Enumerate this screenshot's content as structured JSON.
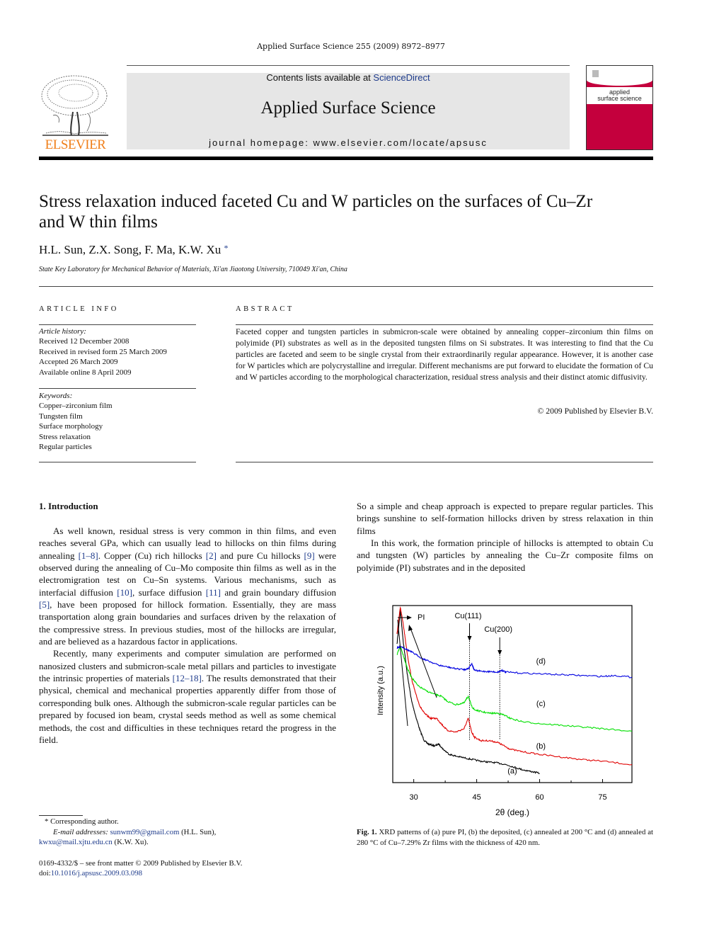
{
  "header": {
    "citation": "Applied Surface Science 255 (2009) 8972–8977",
    "contents_prefix": "Contents lists available at ",
    "contents_link": "ScienceDirect",
    "journal_name": "Applied Surface Science",
    "homepage": "journal homepage: www.elsevier.com/locate/apsusc",
    "publisher_logo_text": "ELSEVIER",
    "cover_line1": "applied",
    "cover_line2": "surface science",
    "colors": {
      "publisher_orange": "#f07f1a",
      "link_blue": "#1f3c8c",
      "cover_red": "#c4003d",
      "banner_gray": "#e6e6e6"
    }
  },
  "article": {
    "title": "Stress relaxation induced faceted Cu and W particles on the surfaces of Cu–Zr and W thin films",
    "authors": "H.L. Sun, Z.X. Song, F. Ma, K.W. Xu",
    "author_mark": "*",
    "affiliation": "State Key Laboratory for Mechanical Behavior of Materials, Xi'an Jiaotong University, 710049 Xi'an, China"
  },
  "article_info": {
    "heading": "ARTICLE INFO",
    "history_label": "Article history:",
    "history": [
      "Received 12 December 2008",
      "Received in revised form 25 March 2009",
      "Accepted 26 March 2009",
      "Available online 8 April 2009"
    ],
    "keywords_label": "Keywords:",
    "keywords": [
      "Copper–zirconium film",
      "Tungsten film",
      "Surface morphology",
      "Stress relaxation",
      "Regular particles"
    ]
  },
  "abstract": {
    "heading": "ABSTRACT",
    "text": "Faceted copper and tungsten particles in submicron-scale were obtained by annealing copper–zirconium thin films on polyimide (PI) substrates as well as in the deposited tungsten films on Si substrates. It was interesting to find that the Cu particles are faceted and seem to be single crystal from their extraordinarily regular appearance. However, it is another case for W particles which are polycrystalline and irregular. Different mechanisms are put forward to elucidate the formation of Cu and W particles according to the morphological characterization, residual stress analysis and their distinct atomic diffusivity.",
    "copyright": "© 2009 Published by Elsevier B.V."
  },
  "introduction": {
    "heading": "1.  Introduction",
    "p1": [
      {
        "t": "As well known, residual stress is very common in thin films, and even reaches several GPa, which can usually lead to hillocks on thin films during annealing "
      },
      {
        "r": "[1–8]"
      },
      {
        "t": ". Copper (Cu) rich hillocks "
      },
      {
        "r": "[2]"
      },
      {
        "t": " and pure Cu hillocks "
      },
      {
        "r": "[9]"
      },
      {
        "t": " were observed during the annealing of Cu–Mo composite thin films as well as in the electromigration test on Cu–Sn systems. Various mechanisms, such as interfacial diffusion "
      },
      {
        "r": "[10]"
      },
      {
        "t": ", surface diffusion "
      },
      {
        "r": "[11]"
      },
      {
        "t": " and grain boundary diffusion "
      },
      {
        "r": "[5]"
      },
      {
        "t": ", have been proposed for hillock formation. Essentially, they are mass transportation along grain boundaries and surfaces driven by the relaxation of the compressive stress. In previous studies, most of the hillocks are irregular, and are believed as a hazardous factor in applications."
      }
    ],
    "p2": [
      {
        "t": "Recently, many experiments and computer simulation are performed on nanosized clusters and submicron-scale metal pillars and particles to investigate the intrinsic properties of materials "
      },
      {
        "r": "[12–18]"
      },
      {
        "t": ". The results demonstrated that their physical, chemical and mechanical properties apparently differ from those of corresponding bulk ones. Although the submicron-scale regular particles can be prepared by focused ion beam, crystal seeds method as well as some chemical methods, the cost and difficulties in these techniques retard the progress in the field."
      }
    ],
    "p3": "So a simple and cheap approach is expected to prepare regular particles. This brings sunshine to self-formation hillocks driven by stress relaxation in thin films",
    "p4": "In this work, the formation principle of hillocks is attempted to obtain Cu and tungsten (W) particles by annealing the Cu–Zr composite films on polyimide (PI) substrates and in the deposited"
  },
  "footnote": {
    "star_line": "* Corresponding author.",
    "email_label": "E-mail addresses: ",
    "email1": "sunwm99@gmail.com",
    "email1_owner": " (H.L. Sun),",
    "email2": "kwxu@mail.xjtu.edu.cn",
    "email2_owner": " (K.W. Xu).",
    "issn": "0169-4332/$ – see front matter © 2009 Published by Elsevier B.V.",
    "doi_prefix": "doi:",
    "doi": "10.1016/j.apsusc.2009.03.098"
  },
  "figure": {
    "caption_label": "Fig. 1.",
    "caption_text": " XRD patterns of (a) pure PI, (b) the deposited, (c) annealed at 200 °C and (d) annealed at 280 °C of Cu–7.29% Zr films with the thickness of 420 nm."
  },
  "chart_data": {
    "type": "line",
    "title": "",
    "xlabel": "2θ (deg.)",
    "ylabel": "Intensity (a.u.)",
    "xlim": [
      25,
      82
    ],
    "ylim": [
      0,
      100
    ],
    "xticks": [
      30,
      45,
      60,
      75
    ],
    "yticks_shown": false,
    "grid": false,
    "legend": "inline labels at right",
    "series": [
      {
        "name": "(a)",
        "color": "#000000",
        "label": "(a)",
        "x": [
          26,
          26.8,
          27.5,
          28.5,
          29.5,
          30.5,
          31.5,
          32.5,
          33.5,
          35,
          36,
          37,
          38.5,
          40,
          42,
          44,
          46,
          48,
          50,
          52,
          54,
          56,
          58,
          60
        ],
        "y": [
          78,
          98,
          80,
          60,
          45,
          36,
          28,
          22,
          20,
          19,
          20,
          17,
          14,
          13,
          12,
          11,
          10,
          9.5,
          9,
          8,
          6.5,
          5,
          4,
          3
        ]
      },
      {
        "name": "(b)",
        "color": "#e00000",
        "label": "(b)",
        "x": [
          26,
          26.8,
          27.5,
          28.5,
          29.5,
          30.5,
          31.5,
          32.5,
          34,
          35.5,
          36.5,
          38,
          40,
          42,
          43,
          43.8,
          44.5,
          46,
          48,
          50,
          51.5,
          53,
          56,
          60,
          65,
          70,
          75,
          82
        ],
        "y": [
          84,
          100,
          90,
          72,
          58,
          49,
          42,
          38,
          35,
          35,
          32,
          28,
          27,
          29,
          35,
          27,
          24,
          22,
          22,
          21,
          19,
          17,
          15.5,
          14,
          12.5,
          11,
          10,
          8
        ]
      },
      {
        "name": "(c)",
        "color": "#00e000",
        "label": "(c)",
        "x": [
          26,
          26.8,
          27.5,
          28.5,
          29.5,
          31,
          33,
          35,
          36.5,
          38,
          40,
          42,
          43,
          43.8,
          44.5,
          46,
          48,
          50,
          51.5,
          53,
          56,
          60,
          65,
          70,
          75,
          82
        ],
        "y": [
          72,
          77,
          72,
          64,
          59,
          54,
          51,
          49,
          48,
          45,
          43,
          44,
          48,
          42,
          40,
          39,
          38,
          38,
          37,
          35,
          33,
          32,
          31,
          30,
          29,
          27.5
        ]
      },
      {
        "name": "(d)",
        "color": "#0000e0",
        "label": "(d)",
        "x": [
          26,
          27,
          28.5,
          30,
          32,
          34,
          36,
          38,
          40,
          42,
          43,
          43.8,
          44.5,
          46,
          48,
          50,
          51,
          52,
          55,
          60,
          65,
          70,
          75,
          78,
          82
        ],
        "y": [
          76,
          77,
          75,
          73,
          70,
          68,
          66,
          65,
          64,
          63.5,
          64,
          67,
          63,
          62.5,
          62.3,
          62,
          63,
          62,
          61.5,
          61,
          60.5,
          60,
          59.5,
          60,
          59
        ]
      }
    ],
    "annotations": [
      {
        "text": "PI",
        "points_to": [
          27.5,
          46
        ]
      },
      {
        "text": "Cu(111)",
        "x": 43.3,
        "marker": "dotted line with arrow"
      },
      {
        "text": "Cu(200)",
        "x": 50.5,
        "marker": "dotted line with arrow"
      }
    ]
  }
}
